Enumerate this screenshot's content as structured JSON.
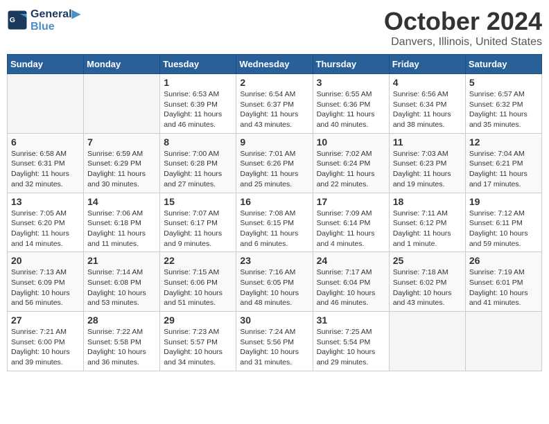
{
  "header": {
    "logo_line1": "General",
    "logo_line2": "Blue",
    "month": "October 2024",
    "location": "Danvers, Illinois, United States"
  },
  "weekdays": [
    "Sunday",
    "Monday",
    "Tuesday",
    "Wednesday",
    "Thursday",
    "Friday",
    "Saturday"
  ],
  "weeks": [
    [
      {
        "day": "",
        "empty": true
      },
      {
        "day": "",
        "empty": true
      },
      {
        "day": "1",
        "sunrise": "Sunrise: 6:53 AM",
        "sunset": "Sunset: 6:39 PM",
        "daylight": "Daylight: 11 hours and 46 minutes."
      },
      {
        "day": "2",
        "sunrise": "Sunrise: 6:54 AM",
        "sunset": "Sunset: 6:37 PM",
        "daylight": "Daylight: 11 hours and 43 minutes."
      },
      {
        "day": "3",
        "sunrise": "Sunrise: 6:55 AM",
        "sunset": "Sunset: 6:36 PM",
        "daylight": "Daylight: 11 hours and 40 minutes."
      },
      {
        "day": "4",
        "sunrise": "Sunrise: 6:56 AM",
        "sunset": "Sunset: 6:34 PM",
        "daylight": "Daylight: 11 hours and 38 minutes."
      },
      {
        "day": "5",
        "sunrise": "Sunrise: 6:57 AM",
        "sunset": "Sunset: 6:32 PM",
        "daylight": "Daylight: 11 hours and 35 minutes."
      }
    ],
    [
      {
        "day": "6",
        "sunrise": "Sunrise: 6:58 AM",
        "sunset": "Sunset: 6:31 PM",
        "daylight": "Daylight: 11 hours and 32 minutes."
      },
      {
        "day": "7",
        "sunrise": "Sunrise: 6:59 AM",
        "sunset": "Sunset: 6:29 PM",
        "daylight": "Daylight: 11 hours and 30 minutes."
      },
      {
        "day": "8",
        "sunrise": "Sunrise: 7:00 AM",
        "sunset": "Sunset: 6:28 PM",
        "daylight": "Daylight: 11 hours and 27 minutes."
      },
      {
        "day": "9",
        "sunrise": "Sunrise: 7:01 AM",
        "sunset": "Sunset: 6:26 PM",
        "daylight": "Daylight: 11 hours and 25 minutes."
      },
      {
        "day": "10",
        "sunrise": "Sunrise: 7:02 AM",
        "sunset": "Sunset: 6:24 PM",
        "daylight": "Daylight: 11 hours and 22 minutes."
      },
      {
        "day": "11",
        "sunrise": "Sunrise: 7:03 AM",
        "sunset": "Sunset: 6:23 PM",
        "daylight": "Daylight: 11 hours and 19 minutes."
      },
      {
        "day": "12",
        "sunrise": "Sunrise: 7:04 AM",
        "sunset": "Sunset: 6:21 PM",
        "daylight": "Daylight: 11 hours and 17 minutes."
      }
    ],
    [
      {
        "day": "13",
        "sunrise": "Sunrise: 7:05 AM",
        "sunset": "Sunset: 6:20 PM",
        "daylight": "Daylight: 11 hours and 14 minutes."
      },
      {
        "day": "14",
        "sunrise": "Sunrise: 7:06 AM",
        "sunset": "Sunset: 6:18 PM",
        "daylight": "Daylight: 11 hours and 11 minutes."
      },
      {
        "day": "15",
        "sunrise": "Sunrise: 7:07 AM",
        "sunset": "Sunset: 6:17 PM",
        "daylight": "Daylight: 11 hours and 9 minutes."
      },
      {
        "day": "16",
        "sunrise": "Sunrise: 7:08 AM",
        "sunset": "Sunset: 6:15 PM",
        "daylight": "Daylight: 11 hours and 6 minutes."
      },
      {
        "day": "17",
        "sunrise": "Sunrise: 7:09 AM",
        "sunset": "Sunset: 6:14 PM",
        "daylight": "Daylight: 11 hours and 4 minutes."
      },
      {
        "day": "18",
        "sunrise": "Sunrise: 7:11 AM",
        "sunset": "Sunset: 6:12 PM",
        "daylight": "Daylight: 11 hours and 1 minute."
      },
      {
        "day": "19",
        "sunrise": "Sunrise: 7:12 AM",
        "sunset": "Sunset: 6:11 PM",
        "daylight": "Daylight: 10 hours and 59 minutes."
      }
    ],
    [
      {
        "day": "20",
        "sunrise": "Sunrise: 7:13 AM",
        "sunset": "Sunset: 6:09 PM",
        "daylight": "Daylight: 10 hours and 56 minutes."
      },
      {
        "day": "21",
        "sunrise": "Sunrise: 7:14 AM",
        "sunset": "Sunset: 6:08 PM",
        "daylight": "Daylight: 10 hours and 53 minutes."
      },
      {
        "day": "22",
        "sunrise": "Sunrise: 7:15 AM",
        "sunset": "Sunset: 6:06 PM",
        "daylight": "Daylight: 10 hours and 51 minutes."
      },
      {
        "day": "23",
        "sunrise": "Sunrise: 7:16 AM",
        "sunset": "Sunset: 6:05 PM",
        "daylight": "Daylight: 10 hours and 48 minutes."
      },
      {
        "day": "24",
        "sunrise": "Sunrise: 7:17 AM",
        "sunset": "Sunset: 6:04 PM",
        "daylight": "Daylight: 10 hours and 46 minutes."
      },
      {
        "day": "25",
        "sunrise": "Sunrise: 7:18 AM",
        "sunset": "Sunset: 6:02 PM",
        "daylight": "Daylight: 10 hours and 43 minutes."
      },
      {
        "day": "26",
        "sunrise": "Sunrise: 7:19 AM",
        "sunset": "Sunset: 6:01 PM",
        "daylight": "Daylight: 10 hours and 41 minutes."
      }
    ],
    [
      {
        "day": "27",
        "sunrise": "Sunrise: 7:21 AM",
        "sunset": "Sunset: 6:00 PM",
        "daylight": "Daylight: 10 hours and 39 minutes."
      },
      {
        "day": "28",
        "sunrise": "Sunrise: 7:22 AM",
        "sunset": "Sunset: 5:58 PM",
        "daylight": "Daylight: 10 hours and 36 minutes."
      },
      {
        "day": "29",
        "sunrise": "Sunrise: 7:23 AM",
        "sunset": "Sunset: 5:57 PM",
        "daylight": "Daylight: 10 hours and 34 minutes."
      },
      {
        "day": "30",
        "sunrise": "Sunrise: 7:24 AM",
        "sunset": "Sunset: 5:56 PM",
        "daylight": "Daylight: 10 hours and 31 minutes."
      },
      {
        "day": "31",
        "sunrise": "Sunrise: 7:25 AM",
        "sunset": "Sunset: 5:54 PM",
        "daylight": "Daylight: 10 hours and 29 minutes."
      },
      {
        "day": "",
        "empty": true
      },
      {
        "day": "",
        "empty": true
      }
    ]
  ]
}
